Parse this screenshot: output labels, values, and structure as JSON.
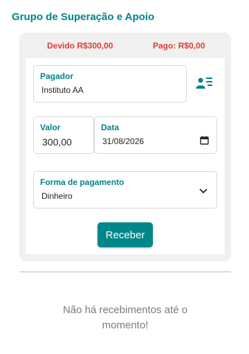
{
  "header": {
    "title": "Grupo de Superação e Apoio"
  },
  "summary": {
    "due": "Devido R$300,00",
    "paid": "Pago: R$0,00"
  },
  "form": {
    "payer": {
      "label": "Pagador",
      "value": "Instituto AA"
    },
    "amount": {
      "label": "Valor",
      "value": "300,00"
    },
    "date": {
      "label": "Data",
      "value": "31/08/2026"
    },
    "payment_method": {
      "label": "Forma de pagamento",
      "value": "Dinheiro"
    },
    "submit_label": "Receber"
  },
  "receipts": {
    "empty_message": "Não há recebimentos até o momento!"
  },
  "colors": {
    "accent": "#00838a",
    "alert": "#e53935",
    "card_bg": "#f0f0f0"
  },
  "icons": {
    "contact_picker": "person-list-icon",
    "date": "calendar-icon",
    "dropdown": "chevron-down-icon"
  }
}
